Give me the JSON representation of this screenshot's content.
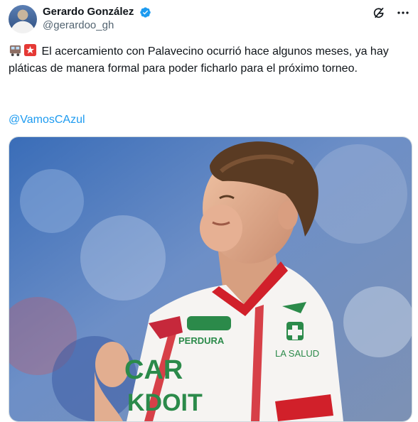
{
  "author": {
    "display_name": "Gerardo González",
    "handle": "@gerardoo_gh"
  },
  "post": {
    "text": "El acercamiento con Palavecino ocurrió hace algunos meses, ya hay pláticas de manera formal para poder ficharlo para el próximo torneo.",
    "mention": "@VamosCAzul"
  },
  "jersey": {
    "sponsor_top": "PERDURA",
    "brand": "LA SALUD",
    "sponsor_main": "CAR",
    "sponsor_second": "KDOIT"
  },
  "icons": [
    "verified-badge-icon",
    "grok-icon",
    "more-icon",
    "train-emoji",
    "train-emoji-2"
  ],
  "colors": {
    "link": "#1d9bf0",
    "verified": "#1d9bf0",
    "text": "#0f1419",
    "secondary": "#536471"
  }
}
